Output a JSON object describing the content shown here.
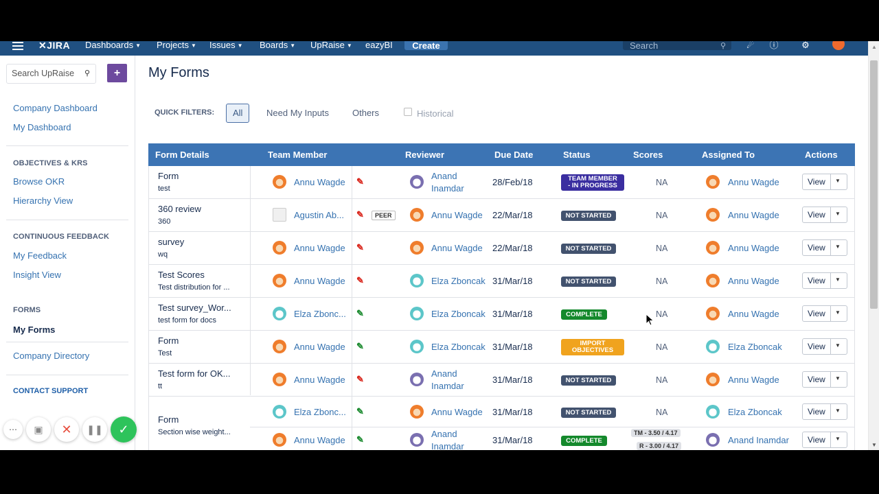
{
  "nav": {
    "logo": "JIRA",
    "items": [
      "Dashboards",
      "Projects",
      "Issues",
      "Boards",
      "UpRaise",
      "eazyBI"
    ],
    "create": "Create",
    "search_placeholder": "Search"
  },
  "sidebar": {
    "search_placeholder": "Search UpRaise",
    "links1": [
      "Company Dashboard",
      "My Dashboard"
    ],
    "okr_head": "OBJECTIVES & KRS",
    "links2": [
      "Browse OKR",
      "Hierarchy View"
    ],
    "feedback_head": "CONTINUOUS FEEDBACK",
    "links3": [
      "My Feedback",
      "Insight View"
    ],
    "forms_head": "FORMS",
    "active": "My Forms",
    "company_directory": "Company Directory",
    "contact": "CONTACT SUPPORT"
  },
  "main": {
    "title": "My Forms",
    "quick_filters_label": "QUICK FILTERS:",
    "filters": [
      "All",
      "Need My Inputs",
      "Others"
    ],
    "historical": "Historical"
  },
  "table": {
    "headers": [
      "Form Details",
      "Team Member",
      "Reviewer",
      "Due Date",
      "Status",
      "Scores",
      "Assigned To",
      "Actions"
    ],
    "view_label": "View",
    "rows": [
      {
        "form": "Form",
        "sub": "test",
        "member": "Annu Wagde",
        "reviewer1": "Anand",
        "reviewer2": "Inamdar",
        "due": "28/Feb/18",
        "status1": "TEAM MEMBER",
        "status2": "- IN PROGRESS",
        "score": "NA",
        "assigned": "Annu Wagde"
      },
      {
        "form": "360 review",
        "sub": "360",
        "member": "Agustin Ab...",
        "peer": "PEER",
        "reviewer": "Annu Wagde",
        "due": "22/Mar/18",
        "status": "NOT STARTED",
        "score": "NA",
        "assigned": "Annu Wagde"
      },
      {
        "form": "survey",
        "sub": "wq",
        "member": "Annu Wagde",
        "reviewer": "Annu Wagde",
        "due": "22/Mar/18",
        "status": "NOT STARTED",
        "score": "NA",
        "assigned": "Annu Wagde"
      },
      {
        "form": "Test Scores",
        "sub": "Test distribution for ...",
        "member": "Annu Wagde",
        "reviewer": "Elza Zboncak",
        "due": "31/Mar/18",
        "status": "NOT STARTED",
        "score": "NA",
        "assigned": "Annu Wagde"
      },
      {
        "form": "Test survey_Wor...",
        "sub": "test form for docs",
        "member": "Elza Zbonc...",
        "reviewer": "Elza Zboncak",
        "due": "31/Mar/18",
        "status": "COMPLETE",
        "score": "NA",
        "assigned": "Annu Wagde"
      },
      {
        "form": "Form",
        "sub": "Test",
        "member": "Annu Wagde",
        "reviewer": "Elza Zboncak",
        "due": "31/Mar/18",
        "status1": "IMPORT",
        "status2": "OBJECTIVES",
        "score": "NA",
        "assigned": "Elza Zboncak"
      },
      {
        "form": "Test form for OK...",
        "sub": "tt",
        "member": "Annu Wagde",
        "reviewer1": "Anand",
        "reviewer2": "Inamdar",
        "due": "31/Mar/18",
        "status": "NOT STARTED",
        "score": "NA",
        "assigned": "Annu Wagde"
      },
      {
        "form": "Form",
        "sub": "Section wise weight...",
        "member": "Elza Zbonc...",
        "reviewer": "Annu Wagde",
        "due": "31/Mar/18",
        "status": "NOT STARTED",
        "score": "NA",
        "assigned": "Elza Zboncak"
      },
      {
        "member": "Annu Wagde",
        "reviewer1": "Anand",
        "reviewer2": "Inamdar",
        "due": "31/Mar/18",
        "status": "COMPLETE",
        "score1": "TM - 3.50 / 4.17",
        "score2": "R - 3.00 / 4.17",
        "assigned": "Anand Inamdar"
      }
    ]
  },
  "colors": {
    "nav": "#205081",
    "table_header": "#3c74b4",
    "not_started": "#42526e",
    "complete": "#14892c",
    "in_progress": "#3a2ea0",
    "import": "#f0a31e",
    "plus": "#6d4a9e"
  }
}
